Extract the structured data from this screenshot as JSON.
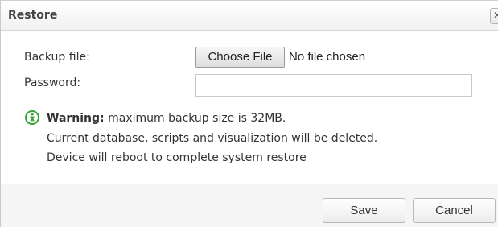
{
  "dialog": {
    "title": "Restore",
    "close_glyph": "✕",
    "icons": {
      "close": "close-icon",
      "warning": "warning-info-icon"
    },
    "colors": {
      "warning_icon": "#3aa335"
    }
  },
  "form": {
    "backup_file_label": "Backup file:",
    "choose_file_label": "Choose File",
    "no_file_text": "No file chosen",
    "password_label": "Password:",
    "password_value": ""
  },
  "warning": {
    "heading": "Warning:",
    "line1": " maximum backup size is 32MB.",
    "line2": "Current database, scripts and visualization will be deleted.",
    "line3": "Device will reboot to complete system restore"
  },
  "footer": {
    "save_label": "Save",
    "cancel_label": "Cancel"
  }
}
